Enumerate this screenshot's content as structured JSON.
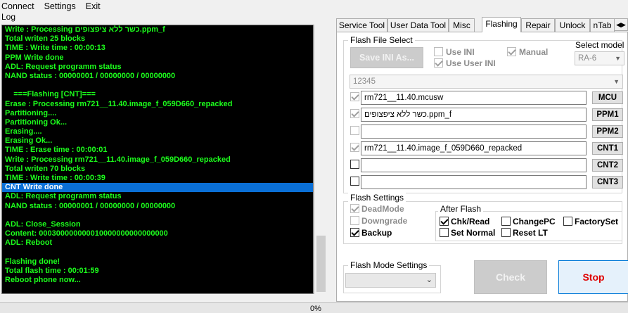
{
  "menu": {
    "items": [
      "Connect",
      "Settings",
      "Exit"
    ]
  },
  "log": {
    "label": "Log",
    "lines": [
      "Write : Processing כשר ללא ציפצופים.ppm_f",
      "Total writen 25 blocks",
      "TIME : Write time : 00:00:13",
      "PPM Write done",
      "ADL: Request programm status",
      "NAND status : 00000001 / 00000000 / 00000000",
      "",
      "    ===Flashing [CNT]===",
      "Erase : Processing rm721__11.40.image_f_059D660_repacked",
      "Partitioning....",
      "Partitioning Ok...",
      "Erasing....",
      "Erasing Ok...",
      "TIME : Erase time : 00:00:01",
      "Write : Processing rm721__11.40.image_f_059D660_repacked",
      "Total writen 70 blocks",
      "TIME : Write time : 00:00:39",
      "CNT Write done",
      "ADL: Request programm status",
      "NAND status : 00000001 / 00000000 / 00000000",
      "",
      "ADL: Close_Session",
      "Content: 000300000000010000000000000000",
      "ADL: Reboot",
      "",
      "Flashing done!",
      "Total flash time : 00:01:59",
      "Reboot phone now..."
    ]
  },
  "progress": {
    "text": "0%"
  },
  "tabs": [
    "Service Tool",
    "User Data Tool",
    "Misc",
    "Flashing",
    "Repair",
    "Unlock",
    "nTab"
  ],
  "flash_file_select": {
    "title": "Flash File Select",
    "save_ini": "Save INI As...",
    "use_ini": "Use INI",
    "use_user_ini": "Use User INI",
    "manual": "Manual",
    "select_model_label": "Select model",
    "model": "RA-6",
    "ini_value": "12345",
    "slots": [
      {
        "path": "rm721__11.40.mcusw",
        "button": "MCU"
      },
      {
        "path": "כשר ללא ציפצופים.ppm_f",
        "button": "PPM1"
      },
      {
        "path": "",
        "button": "PPM2"
      },
      {
        "path": "rm721__11.40.image_f_059D660_repacked",
        "button": "CNT1"
      },
      {
        "path": "",
        "button": "CNT2"
      },
      {
        "path": "",
        "button": "CNT3"
      }
    ]
  },
  "flash_settings": {
    "title": "Flash Settings",
    "deadmode": "DeadMode",
    "downgrade": "Downgrade",
    "backup": "Backup",
    "after_flash": {
      "title": "After Flash",
      "chk_read": "Chk/Read",
      "change_pc": "ChangePC",
      "factory_set": "FactorySet",
      "set_normal": "Set Normal",
      "reset_lt": "Reset LT"
    }
  },
  "flash_mode": {
    "title": "Flash Mode Settings",
    "value": ""
  },
  "actions": {
    "check": "Check",
    "stop": "Stop"
  },
  "colors": {
    "console_bg": "#000000",
    "console_text": "#1cff1c",
    "highlight": "#0a6fd6",
    "stop_text": "#e00000"
  }
}
